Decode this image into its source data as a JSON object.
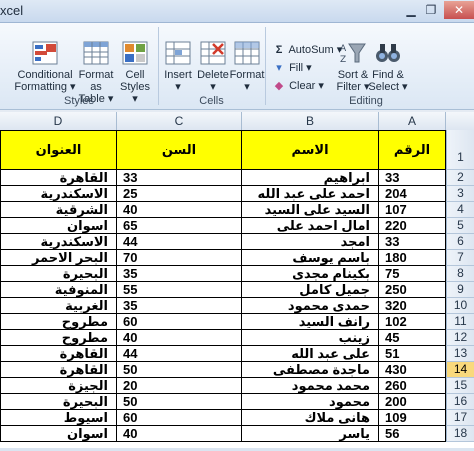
{
  "window": {
    "title": "xcel",
    "min": "▁",
    "max": "❐",
    "close": "✕"
  },
  "ribbon": {
    "styles": {
      "label": "Styles",
      "conditional": "Conditional\nFormatting ▾",
      "format_table": "Format\nas Table ▾",
      "cell_styles": "Cell\nStyles ▾"
    },
    "cells": {
      "label": "Cells",
      "insert": "Insert\n▾",
      "delete": "Delete\n▾",
      "format": "Format\n▾"
    },
    "editing": {
      "label": "Editing",
      "autosum": "AutoSum ▾",
      "fill": "Fill ▾",
      "clear": "Clear ▾",
      "sort": "Sort &\nFilter ▾",
      "find": "Find &\nSelect ▾"
    }
  },
  "sheet": {
    "columns": [
      "D",
      "C",
      "B",
      "A"
    ],
    "selected_row": 14,
    "header_values": [
      "العنوان",
      "السن",
      "الاسم",
      "الرقم"
    ],
    "header_row_number": 1,
    "rows": [
      {
        "n": 2,
        "d": "القاهرة",
        "c": "33",
        "b": "ابراهيم",
        "a": "33"
      },
      {
        "n": 3,
        "d": "الاسكندرية",
        "c": "25",
        "b": "احمد على عبد الله",
        "a": "204"
      },
      {
        "n": 4,
        "d": "الشرقية",
        "c": "40",
        "b": "السيد على السيد",
        "a": "107"
      },
      {
        "n": 5,
        "d": "اسوان",
        "c": "65",
        "b": "امال احمد على",
        "a": "220"
      },
      {
        "n": 6,
        "d": "الاسكندرية",
        "c": "44",
        "b": "امجد",
        "a": "33"
      },
      {
        "n": 7,
        "d": "البحر الاحمر",
        "c": "70",
        "b": "باسم يوسف",
        "a": "180"
      },
      {
        "n": 8,
        "d": "البحيرة",
        "c": "35",
        "b": "بكينام مجدى",
        "a": "75"
      },
      {
        "n": 9,
        "d": "المنوفية",
        "c": "55",
        "b": "جميل كامل",
        "a": "250"
      },
      {
        "n": 10,
        "d": "الغربية",
        "c": "35",
        "b": "حمدى محمود",
        "a": "320"
      },
      {
        "n": 11,
        "d": "مطروح",
        "c": "60",
        "b": "رانف السيد",
        "a": "102"
      },
      {
        "n": 12,
        "d": "مطروح",
        "c": "40",
        "b": "زينب",
        "a": "45"
      },
      {
        "n": 13,
        "d": "القاهرة",
        "c": "44",
        "b": "على عبد الله",
        "a": "51"
      },
      {
        "n": 14,
        "d": "القاهرة",
        "c": "50",
        "b": "ماجدة مصطفى",
        "a": "430"
      },
      {
        "n": 15,
        "d": "الجيزة",
        "c": "20",
        "b": "محمد محمود",
        "a": "260"
      },
      {
        "n": 16,
        "d": "البحيرة",
        "c": "50",
        "b": "محمود",
        "a": "200"
      },
      {
        "n": 17,
        "d": "اسيوط",
        "c": "60",
        "b": "هانى ملاك",
        "a": "109"
      },
      {
        "n": 18,
        "d": "اسوان",
        "c": "40",
        "b": "ياسر",
        "a": "56"
      }
    ]
  },
  "colors": {
    "header_fill": "#ffff00",
    "selected_row_header": "#f9d97c"
  }
}
